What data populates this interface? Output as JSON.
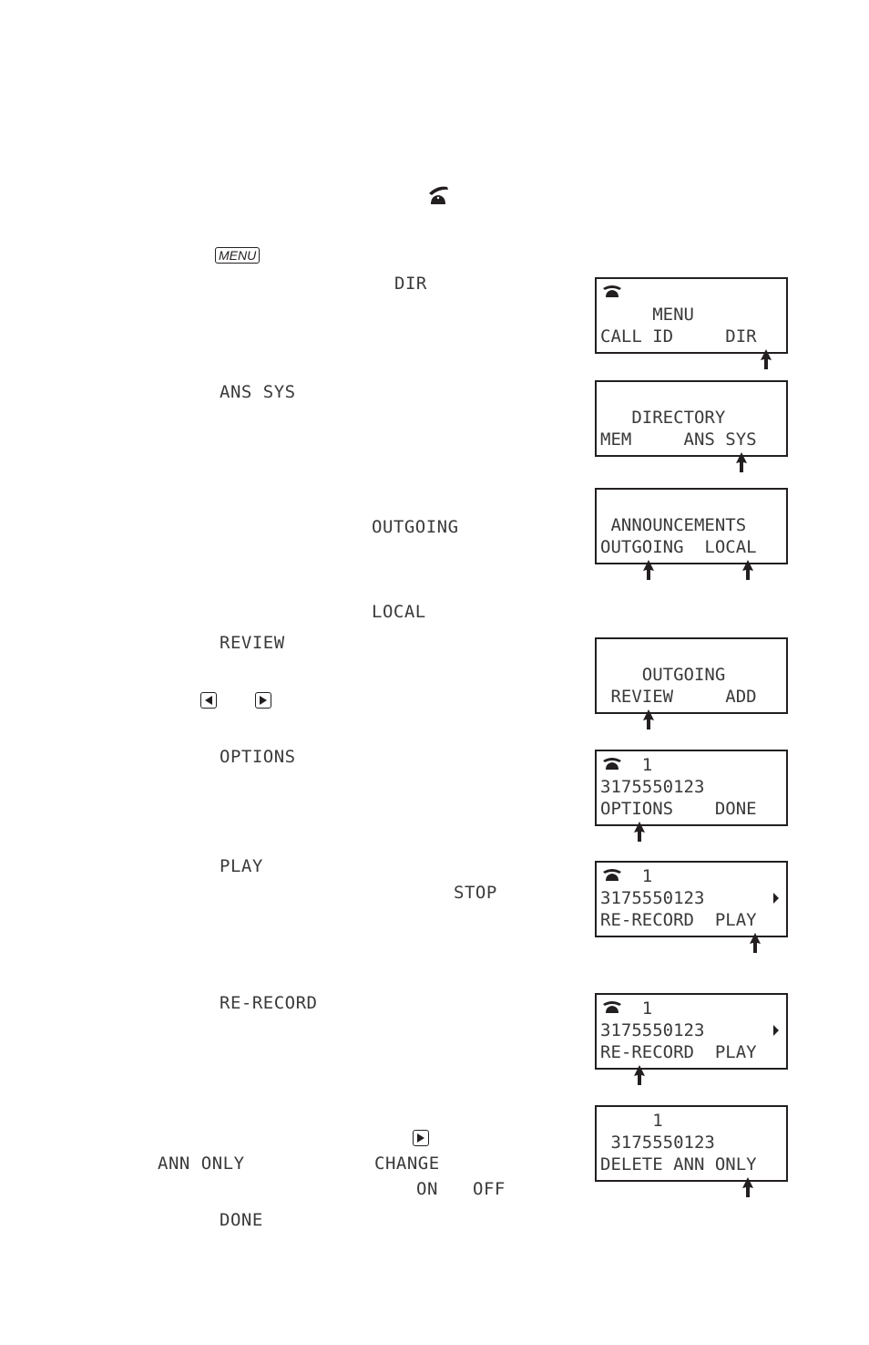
{
  "inline": {
    "phone_icon": "phone-offhook-icon",
    "menu_key": "MENU",
    "dir": "DIR",
    "ans_sys": "ANS SYS",
    "outgoing": "OUTGOING",
    "local": "LOCAL",
    "review": "REVIEW",
    "left_key": "left-arrow-key-icon",
    "right_key": "right-arrow-key-icon",
    "options": "OPTIONS",
    "play": "PLAY",
    "stop": "STOP",
    "re_record": "RE-RECORD",
    "ann_only": "ANN ONLY",
    "change": "CHANGE",
    "on": "ON",
    "off": "OFF",
    "done": "DONE"
  },
  "screens": [
    {
      "icon": "phone-icon",
      "line1": "",
      "line2": "     MENU",
      "line3": "CALL ID     DIR",
      "pointer": "DIR"
    },
    {
      "line1": "",
      "line2": "   DIRECTORY",
      "line3": "MEM     ANS SYS",
      "pointer": "ANS SYS"
    },
    {
      "line1": "",
      "line2": " ANNOUNCEMENTS",
      "line3": "OUTGOING  LOCAL",
      "pointers": [
        "OUTGOING",
        "LOCAL"
      ]
    },
    {
      "line1": "",
      "line2": "    OUTGOING",
      "line3": " REVIEW     ADD",
      "pointer": "REVIEW"
    },
    {
      "icon": "phone-icon",
      "line1": "    1",
      "line2": "3175550123",
      "line3": "OPTIONS    DONE",
      "pointer": "OPTIONS"
    },
    {
      "icon": "phone-icon",
      "line1": "    1",
      "line2": "3175550123",
      "line3": "RE-RECORD  PLAY",
      "indicator": "play-indicator-icon",
      "pointer": "PLAY"
    },
    {
      "icon": "phone-icon",
      "line1": "    1",
      "line2": "3175550123",
      "line3": "RE-RECORD  PLAY",
      "indicator": "play-indicator-icon",
      "pointer": "RE-RECORD"
    },
    {
      "line1": "     1",
      "line2": " 3175550123",
      "line3": "DELETE ANN ONLY",
      "pointer": "ONLY"
    }
  ]
}
